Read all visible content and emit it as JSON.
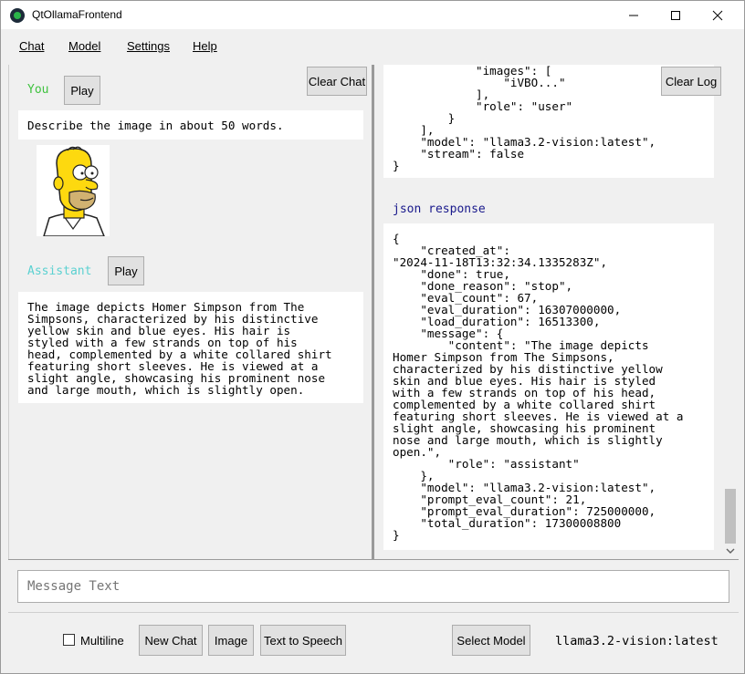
{
  "window": {
    "title": "QtOllamaFrontend"
  },
  "menu": {
    "items": [
      {
        "label": "Chat"
      },
      {
        "label": "Model"
      },
      {
        "label": "Settings"
      },
      {
        "label": "Help"
      }
    ]
  },
  "chat": {
    "clear_chat_label": "Clear Chat",
    "user": {
      "role_label": "You",
      "role_color": "#3fc23f",
      "play_label": "Play",
      "message": "Describe the image in about 50 words.",
      "image_icon": "homer-simpson-image"
    },
    "assistant": {
      "role_label": "Assistant",
      "role_color": "#5bd1d1",
      "play_label": "Play",
      "message_lines": [
        "The image depicts Homer Simpson from The",
        "Simpsons, characterized by his distinctive",
        "yellow skin and blue eyes. His hair is",
        "styled with a few strands on top of his",
        "head, complemented by a white collared shirt",
        "featuring short sleeves. He is viewed at a",
        "slight angle, showcasing his prominent nose",
        "and large mouth, which is slightly open."
      ]
    }
  },
  "log": {
    "clear_log_label": "Clear Log",
    "request_lines": [
      "            \"images\": [",
      "                \"iVBO...\"",
      "            ],",
      "            \"role\": \"user\"",
      "        }",
      "    ],",
      "    \"model\": \"llama3.2-vision:latest\",",
      "    \"stream\": false",
      "}"
    ],
    "response_header": "json response",
    "response_lines": [
      "{",
      "    \"created_at\":",
      "\"2024-11-18T13:32:34.1335283Z\",",
      "    \"done\": true,",
      "    \"done_reason\": \"stop\",",
      "    \"eval_count\": 67,",
      "    \"eval_duration\": 16307000000,",
      "    \"load_duration\": 16513300,",
      "    \"message\": {",
      "        \"content\": \"The image depicts",
      "Homer Simpson from The Simpsons,",
      "characterized by his distinctive yellow",
      "skin and blue eyes. His hair is styled",
      "with a few strands on top of his head,",
      "complemented by a white collared shirt",
      "featuring short sleeves. He is viewed at a",
      "slight angle, showcasing his prominent",
      "nose and large mouth, which is slightly",
      "open.\",",
      "        \"role\": \"assistant\"",
      "    },",
      "    \"model\": \"llama3.2-vision:latest\",",
      "    \"prompt_eval_count\": 21,",
      "    \"prompt_eval_duration\": 725000000,",
      "    \"total_duration\": 17300008800",
      "}"
    ]
  },
  "input": {
    "placeholder": "Message Text"
  },
  "bottom": {
    "multiline_label": "Multiline",
    "multiline_checked": false,
    "new_chat_label": "New Chat",
    "image_label": "Image",
    "tts_label": "Text to Speech",
    "select_model_label": "Select Model",
    "current_model": "llama3.2-vision:latest"
  }
}
